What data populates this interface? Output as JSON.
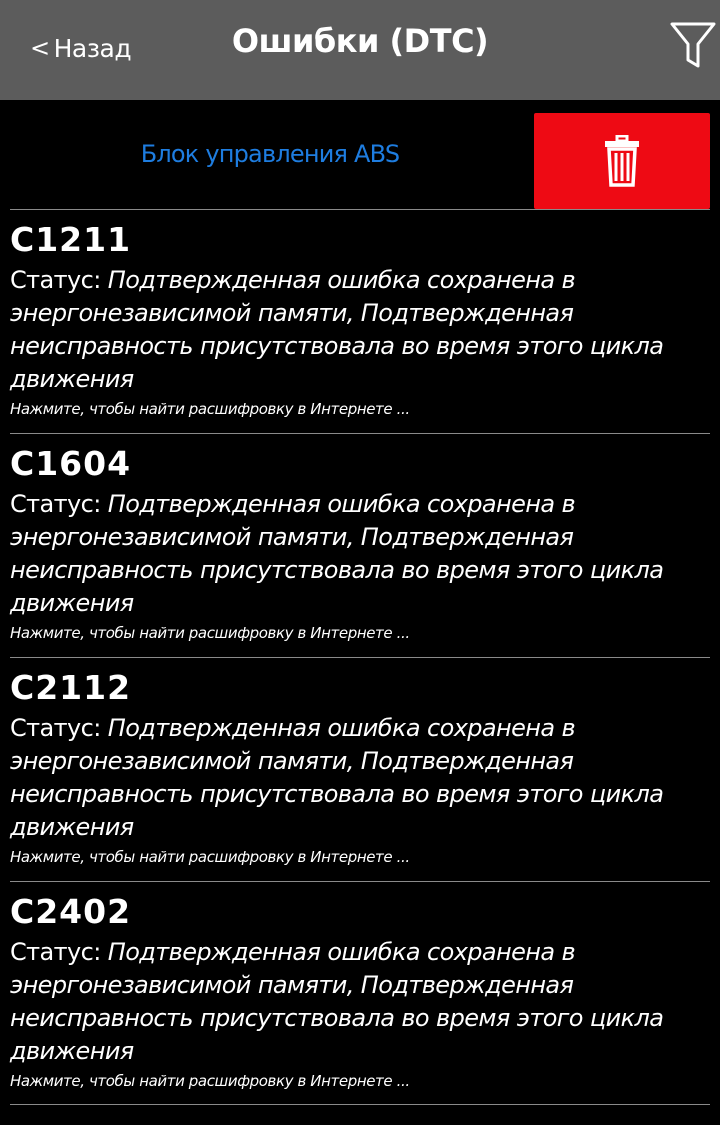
{
  "header": {
    "back_label": "Назад",
    "back_icon": "chevron-left-icon",
    "title": "Ошибки (DTC)",
    "filter_icon": "filter-icon"
  },
  "section": {
    "module": "Блок управления ABS",
    "delete_icon": "trash-icon",
    "delete_color": "#ee0a14",
    "module_color": "#1e7de0"
  },
  "errors": [
    {
      "code": "C1211",
      "status_label": "Статус: ",
      "status_value": "Подтвержденная ошибка сохранена в энергонезависимой памяти, Подтвержденная неисправность присутствовала во время этого цикла движения",
      "hint": "Нажмите, чтобы найти расшифровку в Интернете ..."
    },
    {
      "code": "C1604",
      "status_label": "Статус: ",
      "status_value": "Подтвержденная ошибка сохранена в энергонезависимой памяти, Подтвержденная неисправность присутствовала во время этого цикла движения",
      "hint": "Нажмите, чтобы найти расшифровку в Интернете ..."
    },
    {
      "code": "C2112",
      "status_label": "Статус: ",
      "status_value": "Подтвержденная ошибка сохранена в энергонезависимой памяти, Подтвержденная неисправность присутствовала во время этого цикла движения",
      "hint": "Нажмите, чтобы найти расшифровку в Интернете ..."
    },
    {
      "code": "C2402",
      "status_label": "Статус: ",
      "status_value": "Подтвержденная ошибка сохранена в энергонезависимой памяти, Подтвержденная неисправность присутствовала во время этого цикла движения",
      "hint": "Нажмите, чтобы найти расшифровку в Интернете ..."
    }
  ]
}
